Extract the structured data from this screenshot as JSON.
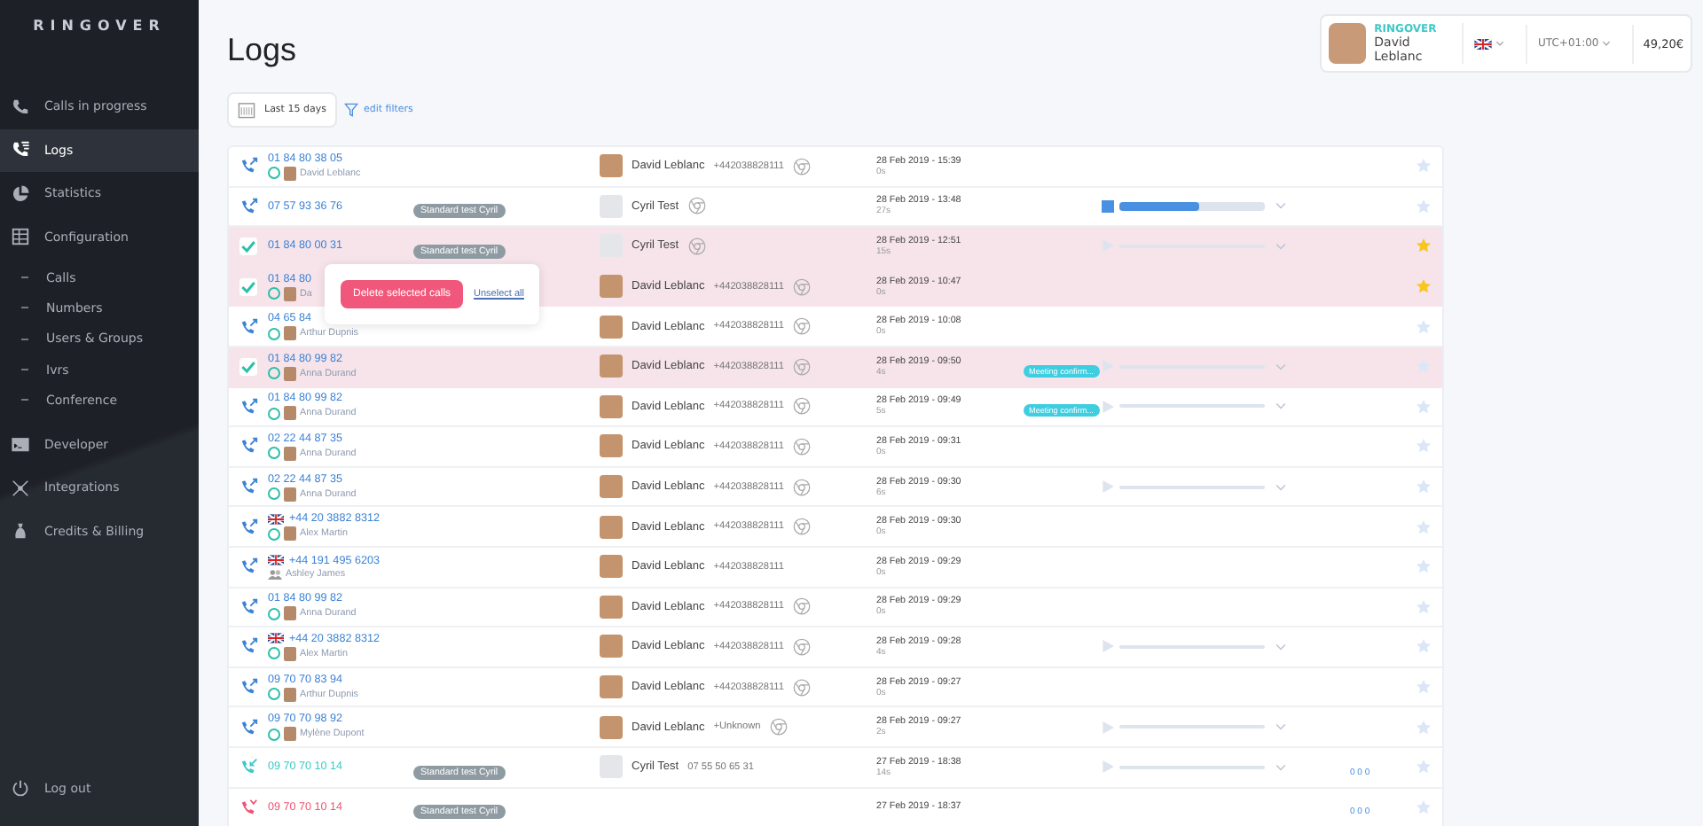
{
  "sidebar": {
    "logo": "RINGOVER",
    "items": [
      {
        "label": "Calls in progress",
        "selected": false
      },
      {
        "label": "Logs",
        "selected": true
      },
      {
        "label": "Statistics",
        "selected": false
      },
      {
        "label": "Configuration",
        "selected": false,
        "children": [
          {
            "label": "Calls"
          },
          {
            "label": "Numbers"
          },
          {
            "label": "Users & Groups"
          },
          {
            "label": "Ivrs"
          },
          {
            "label": "Conference"
          }
        ]
      },
      {
        "label": "Developer",
        "selected": false
      },
      {
        "label": "Integrations",
        "selected": false
      },
      {
        "label": "Credits & Billing",
        "selected": false
      }
    ],
    "logout": "Log out"
  },
  "page": {
    "title": "Logs"
  },
  "filters": {
    "period": "Last 15 days",
    "edit": "edit filters"
  },
  "account": {
    "company": "RINGOVER",
    "user": "David Leblanc",
    "timezone": "UTC+01:00",
    "credit": "49,20€"
  },
  "popup": {
    "delete": "Delete selected calls",
    "unselect": "Unselect all"
  },
  "rows": [
    {
      "selected": false,
      "kind": "outgoing",
      "number": "01 84 80 38 05",
      "flag": false,
      "agent": {
        "name": "David Leblanc",
        "kind": "user"
      },
      "contact": {
        "name": "David Leblanc",
        "number": "+442038828111",
        "photo": true,
        "chrome": true
      },
      "date": "28 Feb 2019 - 15:39",
      "duration": "0s",
      "starred": false
    },
    {
      "selected": false,
      "kind": "outgoing",
      "number": "07 57 93 36 76",
      "flag": false,
      "tag": "Standard test Cyril",
      "contact": {
        "name": "Cyril Test",
        "photo": false,
        "chrome": true
      },
      "date": "28 Feb 2019 - 13:48",
      "duration": "27s",
      "player": {
        "kind": "playing",
        "level": 0.55
      },
      "starred": false
    },
    {
      "selected": true,
      "kind": "outgoing",
      "number": "01 84 80 00 31",
      "flag": false,
      "tag": "Standard test Cyril",
      "contact": {
        "name": "Cyril Test",
        "photo": false,
        "chrome": true
      },
      "date": "28 Feb 2019 - 12:51",
      "duration": "15s",
      "player": {
        "kind": "idle"
      },
      "starred": true
    },
    {
      "selected": true,
      "kind": "outgoing",
      "number": "01 84 80",
      "flag": false,
      "agent": {
        "name": "Da",
        "kind": "user"
      },
      "contact": {
        "name": "David Leblanc",
        "number": "+442038828111",
        "photo": true,
        "chrome": true
      },
      "date": "28 Feb 2019 - 10:47",
      "duration": "0s",
      "starred": true
    },
    {
      "selected": false,
      "kind": "outgoing",
      "number": "04 65 84",
      "flag": false,
      "agent": {
        "name": "Arthur Dupnis",
        "kind": "user"
      },
      "contact": {
        "name": "David Leblanc",
        "number": "+442038828111",
        "photo": true,
        "chrome": true
      },
      "date": "28 Feb 2019 - 10:08",
      "duration": "0s",
      "starred": false
    },
    {
      "selected": true,
      "kind": "outgoing",
      "number": "01 84 80 99 82",
      "flag": false,
      "agent": {
        "name": "Anna Durand",
        "kind": "user"
      },
      "contact": {
        "name": "David Leblanc",
        "number": "+442038828111",
        "photo": true,
        "chrome": true
      },
      "date": "28 Feb 2019 - 09:50",
      "duration": "4s",
      "note": "Meeting confirm...",
      "player": {
        "kind": "idle"
      },
      "starred": false
    },
    {
      "selected": false,
      "kind": "outgoing",
      "number": "01 84 80 99 82",
      "flag": false,
      "agent": {
        "name": "Anna Durand",
        "kind": "user"
      },
      "contact": {
        "name": "David Leblanc",
        "number": "+442038828111",
        "photo": true,
        "chrome": true
      },
      "date": "28 Feb 2019 - 09:49",
      "duration": "5s",
      "note": "Meeting confirm...",
      "player": {
        "kind": "idle"
      },
      "starred": false
    },
    {
      "selected": false,
      "kind": "outgoing",
      "number": "02 22 44 87 35",
      "flag": false,
      "agent": {
        "name": "Anna Durand",
        "kind": "user"
      },
      "contact": {
        "name": "David Leblanc",
        "number": "+442038828111",
        "photo": true,
        "chrome": true
      },
      "date": "28 Feb 2019 - 09:31",
      "duration": "0s",
      "starred": false
    },
    {
      "selected": false,
      "kind": "outgoing",
      "number": "02 22 44 87 35",
      "flag": false,
      "agent": {
        "name": "Anna Durand",
        "kind": "user"
      },
      "contact": {
        "name": "David Leblanc",
        "number": "+442038828111",
        "photo": true,
        "chrome": true
      },
      "date": "28 Feb 2019 - 09:30",
      "duration": "6s",
      "player": {
        "kind": "idle"
      },
      "starred": false
    },
    {
      "selected": false,
      "kind": "outgoing",
      "number": "+44 20 3882 8312",
      "flag": true,
      "agent": {
        "name": "Alex Martin",
        "kind": "user"
      },
      "contact": {
        "name": "David Leblanc",
        "number": "+442038828111",
        "photo": true,
        "chrome": true
      },
      "date": "28 Feb 2019 - 09:30",
      "duration": "0s",
      "starred": false
    },
    {
      "selected": false,
      "kind": "outgoing",
      "number": "+44 191 495 6203",
      "flag": true,
      "agent": {
        "name": "Ashley James",
        "kind": "group"
      },
      "contact": {
        "name": "David Leblanc",
        "number": "+442038828111",
        "photo": true,
        "chrome": false
      },
      "date": "28 Feb 2019 - 09:29",
      "duration": "0s",
      "starred": false
    },
    {
      "selected": false,
      "kind": "outgoing",
      "number": "01 84 80 99 82",
      "flag": false,
      "agent": {
        "name": "Anna Durand",
        "kind": "user"
      },
      "contact": {
        "name": "David Leblanc",
        "number": "+442038828111",
        "photo": true,
        "chrome": true
      },
      "date": "28 Feb 2019 - 09:29",
      "duration": "0s",
      "starred": false
    },
    {
      "selected": false,
      "kind": "outgoing",
      "number": "+44 20 3882 8312",
      "flag": true,
      "agent": {
        "name": "Alex Martin",
        "kind": "user"
      },
      "contact": {
        "name": "David Leblanc",
        "number": "+442038828111",
        "photo": true,
        "chrome": true
      },
      "date": "28 Feb 2019 - 09:28",
      "duration": "4s",
      "player": {
        "kind": "idle"
      },
      "starred": false
    },
    {
      "selected": false,
      "kind": "outgoing",
      "number": "09 70 70 83 94",
      "flag": false,
      "agent": {
        "name": "Arthur Dupnis",
        "kind": "user"
      },
      "contact": {
        "name": "David Leblanc",
        "number": "+442038828111",
        "photo": true,
        "chrome": true
      },
      "date": "28 Feb 2019 - 09:27",
      "duration": "0s",
      "starred": false
    },
    {
      "selected": false,
      "kind": "outgoing",
      "number": "09 70 70 98 92",
      "flag": false,
      "agent": {
        "name": "Mylène Dupont",
        "kind": "user"
      },
      "contact": {
        "name": "David Leblanc",
        "number": "+Unknown",
        "photo": true,
        "chrome": true
      },
      "date": "28 Feb 2019 - 09:27",
      "duration": "2s",
      "player": {
        "kind": "idle"
      },
      "starred": false
    },
    {
      "selected": false,
      "kind": "incoming",
      "number": "09 70 70 10 14",
      "flag": false,
      "tag": "Standard test Cyril",
      "contact": {
        "name": "Cyril Test",
        "number": "07 55 50 65 31",
        "photo": false,
        "chrome": false
      },
      "date": "27 Feb 2019 - 18:38",
      "duration": "14s",
      "player": {
        "kind": "idle"
      },
      "extra": "0 0 0",
      "starred": false
    },
    {
      "selected": false,
      "kind": "missed",
      "number": "09 70 70 10 14",
      "flag": false,
      "tag": "Standard test Cyril",
      "date": "27 Feb 2019 - 18:37",
      "extra": "0 0 0",
      "starred": false
    }
  ]
}
